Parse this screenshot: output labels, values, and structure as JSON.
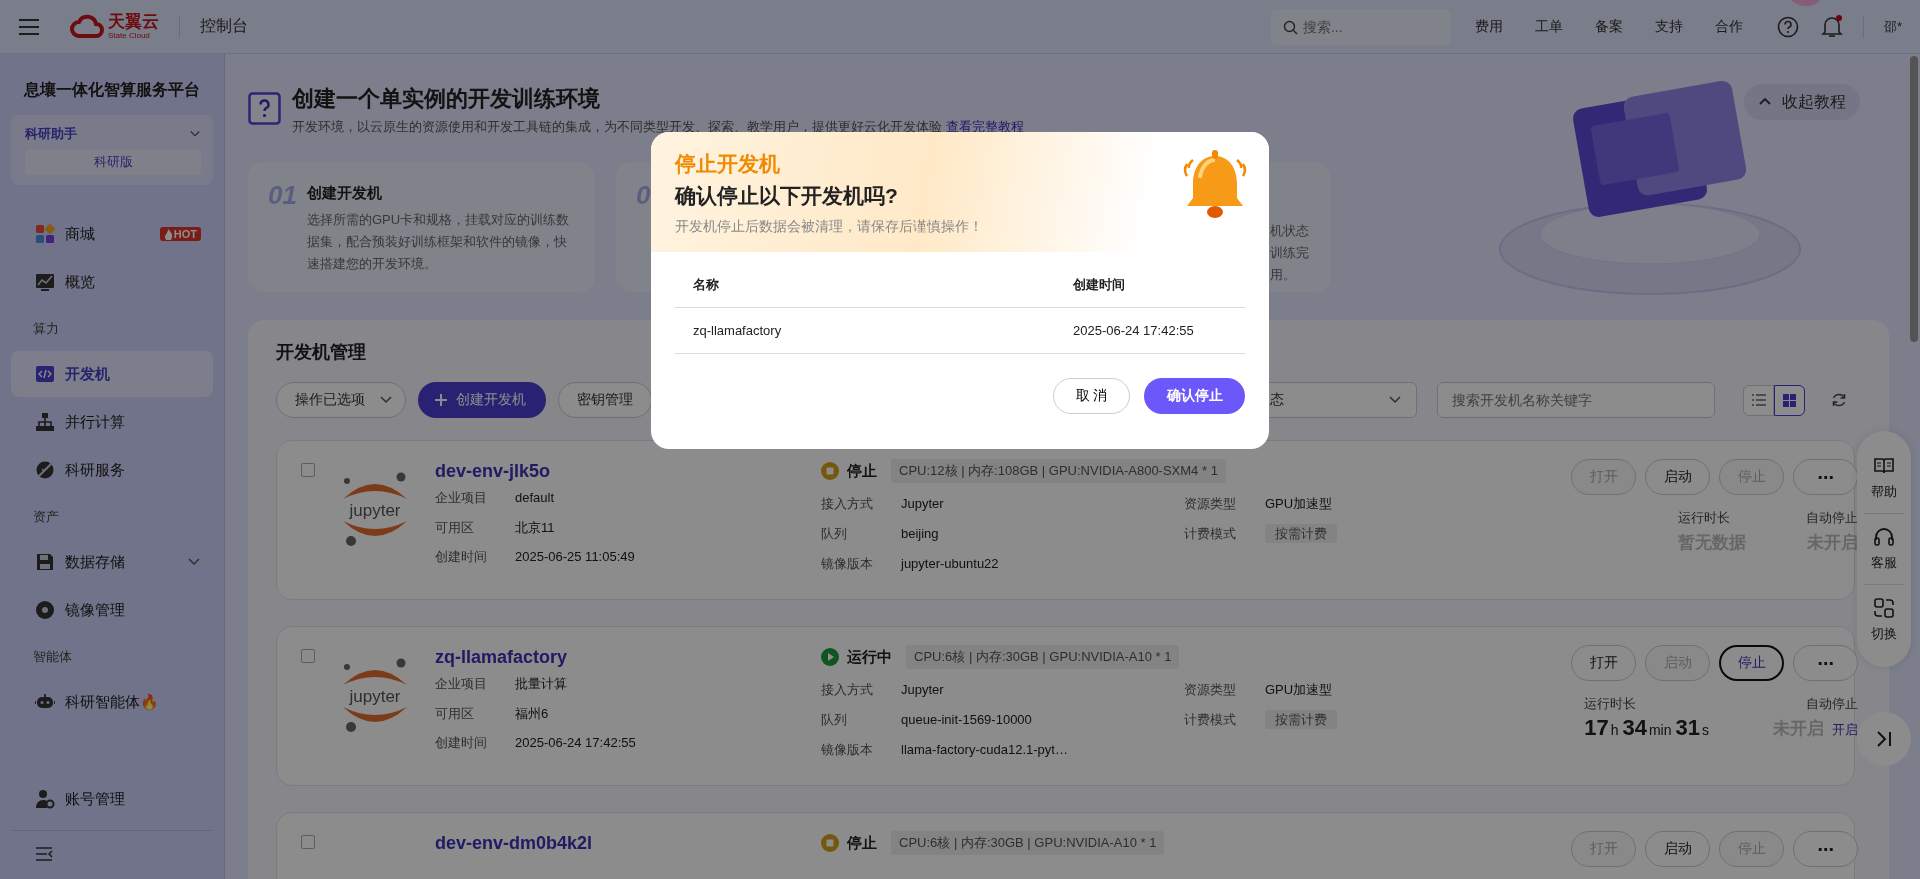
{
  "top_bar": {
    "logo": {
      "name": "天翼云",
      "subtitle": "State Cloud"
    },
    "title": "控制台",
    "search": {
      "placeholder": "搜索..."
    },
    "links": [
      "费用",
      "工单",
      "备案",
      "支持",
      "合作"
    ],
    "notification": {
      "unread": true
    },
    "user": "邵*"
  },
  "sidebar": {
    "title": "息壤一体化智算服务平台",
    "workspace": {
      "label": "科研助手",
      "edition": "科研版"
    },
    "items": [
      {
        "kind": "item",
        "label": "商城",
        "badge": "HOT",
        "selected": false
      },
      {
        "kind": "item",
        "label": "概览",
        "selected": false
      },
      {
        "kind": "section",
        "label": "算力"
      },
      {
        "kind": "item",
        "label": "开发机",
        "selected": true
      },
      {
        "kind": "item",
        "label": "并行计算",
        "selected": false
      },
      {
        "kind": "item",
        "label": "科研服务",
        "selected": false
      },
      {
        "kind": "section",
        "label": "资产"
      },
      {
        "kind": "group",
        "label": "数据存储",
        "selected": false,
        "expanded": false
      },
      {
        "kind": "item",
        "label": "镜像管理",
        "selected": false
      },
      {
        "kind": "section",
        "label": "智能体"
      },
      {
        "kind": "item",
        "label": "科研智能体🔥",
        "selected": false
      }
    ],
    "footer_item": {
      "label": "账号管理",
      "selected": false
    }
  },
  "tutorial": {
    "title": "创建一个单实例的开发训练环境",
    "description": "开发环境，以云原生的资源使用和开发工具链的集成，为不同类型开发、探索、教学用户，提供更好云化开发体验",
    "link": "查看完整教程",
    "collapse_button": "收起教程",
    "steps": [
      {
        "number": "01",
        "title": "创建开发机",
        "text": "选择所需的GPU卡和规格，挂载对应的训练数据集，配合预装好训练框架和软件的镜像，快速搭建您的开发环境。"
      },
      {
        "number": "0"
      },
      {
        "lines": [
          "机状态",
          "训练完",
          "用。"
        ]
      }
    ]
  },
  "management": {
    "title": "开发机管理",
    "toolbar": {
      "bulk_dropdown": "操作已选项",
      "create_button": "创建开发机",
      "key_button": "密钥管理",
      "status_dropdown": "态",
      "search": {
        "placeholder": "搜索开发机名称关键字"
      },
      "views": [
        {
          "kind": "list",
          "selected": false
        },
        {
          "kind": "grid",
          "selected": true
        }
      ]
    },
    "machines": [
      {
        "name": "dev-env-jlk5o",
        "checked": false,
        "logo_text": "jupyter",
        "info": [
          {
            "label": "企业项目",
            "value": "default"
          },
          {
            "label": "可用区",
            "value": "北京11"
          },
          {
            "label": "创建时间",
            "value": "2025-06-25 11:05:49"
          }
        ],
        "status": {
          "kind": "stopped",
          "label": "停止"
        },
        "spec": "CPU:12核 | 内存:108GB | GPU:NVIDIA-A800-SXM4 * 1",
        "specs": [
          {
            "kind": "text",
            "label": "接入方式",
            "value": "Jupyter"
          },
          {
            "kind": "text",
            "label": "资源类型",
            "value": "GPU加速型"
          },
          {
            "kind": "text",
            "label": "队列",
            "value": "beijing"
          },
          {
            "kind": "tag",
            "label": "计费模式",
            "value": "按需计费"
          },
          {
            "kind": "text",
            "label": "镜像版本",
            "value": "jupyter-ubuntu22"
          }
        ],
        "buttons": [
          {
            "kind": "text",
            "label": "打开",
            "disabled": true,
            "focused": false
          },
          {
            "kind": "text",
            "label": "启动",
            "disabled": false,
            "focused": false
          },
          {
            "kind": "text",
            "label": "停止",
            "disabled": true,
            "focused": false
          },
          {
            "kind": "more",
            "label": "⋯",
            "disabled": false,
            "focused": false
          }
        ],
        "runtime": {
          "label": "运行时长",
          "kind": "empty",
          "text": "暂无数据"
        },
        "auto_stop": {
          "label": "自动停止",
          "value": "未开启"
        }
      },
      {
        "name": "zq-llamafactory",
        "checked": false,
        "logo_text": "jupyter",
        "info": [
          {
            "label": "企业项目",
            "value": "批量计算"
          },
          {
            "label": "可用区",
            "value": "福州6"
          },
          {
            "label": "创建时间",
            "value": "2025-06-24 17:42:55"
          }
        ],
        "status": {
          "kind": "running",
          "label": "运行中"
        },
        "spec": "CPU:6核 | 内存:30GB | GPU:NVIDIA-A10 * 1",
        "specs": [
          {
            "kind": "text",
            "label": "接入方式",
            "value": "Jupyter"
          },
          {
            "kind": "text",
            "label": "资源类型",
            "value": "GPU加速型"
          },
          {
            "kind": "text",
            "label": "队列",
            "value": "queue-init-1569-10000"
          },
          {
            "kind": "tag",
            "label": "计费模式",
            "value": "按需计费"
          },
          {
            "kind": "text",
            "label": "镜像版本",
            "value": "llama-factory-cuda12.1-pyt…"
          }
        ],
        "buttons": [
          {
            "kind": "text",
            "label": "打开",
            "disabled": false,
            "focused": false
          },
          {
            "kind": "text",
            "label": "启动",
            "disabled": true,
            "focused": false
          },
          {
            "kind": "text",
            "label": "停止",
            "disabled": false,
            "focused": true
          },
          {
            "kind": "more",
            "label": "⋯",
            "disabled": false,
            "focused": false
          }
        ],
        "runtime": {
          "label": "运行时长",
          "kind": "duration",
          "parts": [
            {
              "value": "17",
              "unit": "h"
            },
            {
              "value": "34",
              "unit": "min"
            },
            {
              "value": "31",
              "unit": "s"
            }
          ]
        },
        "auto_stop": {
          "label": "自动停止",
          "value": "未开启",
          "action": "开启"
        }
      },
      {
        "name": "dev-env-dm0b4k2l",
        "checked": false,
        "status": {
          "kind": "stopped",
          "label": "停止"
        },
        "spec": "CPU:6核 | 内存:30GB | GPU:NVIDIA-A10 * 1",
        "buttons": [
          {
            "kind": "text",
            "label": "打开",
            "disabled": true,
            "focused": false
          },
          {
            "kind": "text",
            "label": "启动",
            "disabled": false,
            "focused": false
          },
          {
            "kind": "text",
            "label": "停止",
            "disabled": true,
            "focused": false
          },
          {
            "kind": "more",
            "label": "⋯",
            "disabled": false,
            "focused": false
          }
        ]
      }
    ]
  },
  "float_panel": {
    "items": [
      "帮助",
      "客服",
      "切换"
    ]
  },
  "dialog": {
    "title": "停止开发机",
    "question": "确认停止以下开发机吗?",
    "warning": "开发机停止后数据会被清理，请保存后谨慎操作！",
    "columns": [
      "名称",
      "创建时间"
    ],
    "rows": [
      [
        "zq-llamafactory",
        "2025-06-24 17:42:55"
      ]
    ],
    "cancel_button": "取 消",
    "confirm_button": "确认停止"
  }
}
